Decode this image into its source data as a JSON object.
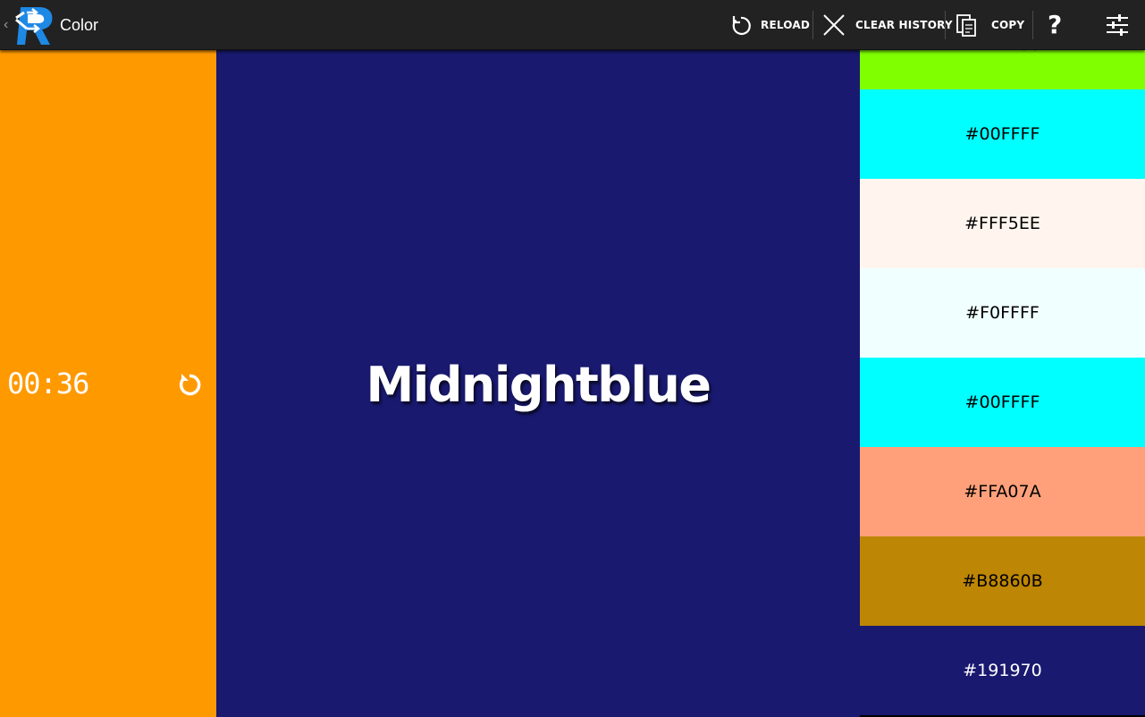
{
  "actionbar": {
    "title": "Color",
    "actions": [
      {
        "label": "RELOAD",
        "icon": "reload-icon"
      },
      {
        "label": "CLEAR HISTORY",
        "icon": "close-icon"
      },
      {
        "label": "COPY",
        "icon": "copy-icon"
      },
      {
        "label": "",
        "icon": "help-icon"
      },
      {
        "label": "",
        "icon": "settings-sliders-icon"
      }
    ],
    "background": "#222222"
  },
  "timer": {
    "value": "00:36",
    "background": "#FF9900",
    "icon": "reset-icon"
  },
  "current_color": {
    "name": "Midnightblue",
    "background": "#191970"
  },
  "history": [
    {
      "hex": "#7FFF00",
      "bg": "#7FFF00",
      "fg": "#000000"
    },
    {
      "hex": "#00FFFF",
      "bg": "#00FFFF",
      "fg": "#000000"
    },
    {
      "hex": "#FFF5EE",
      "bg": "#FFF5EE",
      "fg": "#000000"
    },
    {
      "hex": "#F0FFFF",
      "bg": "#F0FFFF",
      "fg": "#000000"
    },
    {
      "hex": "#00FFFF",
      "bg": "#00FFFF",
      "fg": "#000000"
    },
    {
      "hex": "#FFA07A",
      "bg": "#FFA07A",
      "fg": "#000000"
    },
    {
      "hex": "#B8860B",
      "bg": "#BD8604",
      "fg": "#000000"
    },
    {
      "hex": "#191970",
      "bg": "#191970",
      "fg": "#ffffff"
    }
  ]
}
